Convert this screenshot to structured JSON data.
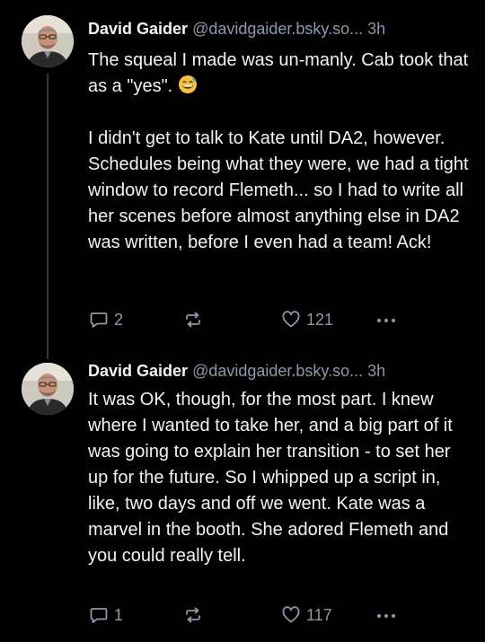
{
  "posts": [
    {
      "author": {
        "name": "David Gaider",
        "handle": "@davidgaider.bsky.so...",
        "avatar_icon": "avatar-photo"
      },
      "time": "3h",
      "paragraphs": [
        "The squeal I made was un-manly. Cab took that as a \"yes\".",
        "I didn't get to talk to Kate until DA2, however. Schedules being what they were, we had a tight window to record Flemeth... so I had to write all her scenes before almost anything else in DA2 was written, before I even had a team! Ack!"
      ],
      "emoji_icon": "grinning-sweat-emoji",
      "actions": {
        "reply_count": "2",
        "like_count": "121"
      }
    },
    {
      "author": {
        "name": "David Gaider",
        "handle": "@davidgaider.bsky.so...",
        "avatar_icon": "avatar-photo"
      },
      "time": "3h",
      "paragraphs": [
        "It was OK, though, for the most part. I knew where I wanted to take her, and a big part of it was going to explain her transition - to set her up for the future. So I whipped up a script in, like, two days and off we went. Kate was a marvel in the booth. She adored Flemeth and you could really tell."
      ],
      "actions": {
        "reply_count": "1",
        "like_count": "117"
      }
    }
  ],
  "colors": {
    "background": "#000000",
    "text": "#f1f3f5",
    "muted": "#8d99a8",
    "thread_line": "#2e3440"
  }
}
